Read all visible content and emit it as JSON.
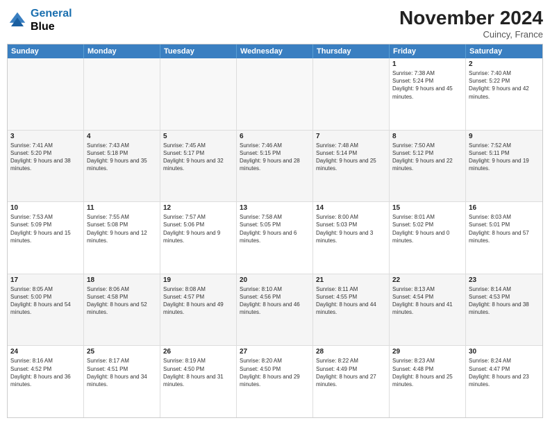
{
  "header": {
    "logo_line1": "General",
    "logo_line2": "Blue",
    "month_title": "November 2024",
    "location": "Cuincy, France"
  },
  "days_of_week": [
    "Sunday",
    "Monday",
    "Tuesday",
    "Wednesday",
    "Thursday",
    "Friday",
    "Saturday"
  ],
  "weeks": [
    [
      {
        "day": "",
        "empty": true
      },
      {
        "day": "",
        "empty": true
      },
      {
        "day": "",
        "empty": true
      },
      {
        "day": "",
        "empty": true
      },
      {
        "day": "",
        "empty": true
      },
      {
        "day": "1",
        "sunrise": "Sunrise: 7:38 AM",
        "sunset": "Sunset: 5:24 PM",
        "daylight": "Daylight: 9 hours and 45 minutes."
      },
      {
        "day": "2",
        "sunrise": "Sunrise: 7:40 AM",
        "sunset": "Sunset: 5:22 PM",
        "daylight": "Daylight: 9 hours and 42 minutes."
      }
    ],
    [
      {
        "day": "3",
        "sunrise": "Sunrise: 7:41 AM",
        "sunset": "Sunset: 5:20 PM",
        "daylight": "Daylight: 9 hours and 38 minutes."
      },
      {
        "day": "4",
        "sunrise": "Sunrise: 7:43 AM",
        "sunset": "Sunset: 5:18 PM",
        "daylight": "Daylight: 9 hours and 35 minutes."
      },
      {
        "day": "5",
        "sunrise": "Sunrise: 7:45 AM",
        "sunset": "Sunset: 5:17 PM",
        "daylight": "Daylight: 9 hours and 32 minutes."
      },
      {
        "day": "6",
        "sunrise": "Sunrise: 7:46 AM",
        "sunset": "Sunset: 5:15 PM",
        "daylight": "Daylight: 9 hours and 28 minutes."
      },
      {
        "day": "7",
        "sunrise": "Sunrise: 7:48 AM",
        "sunset": "Sunset: 5:14 PM",
        "daylight": "Daylight: 9 hours and 25 minutes."
      },
      {
        "day": "8",
        "sunrise": "Sunrise: 7:50 AM",
        "sunset": "Sunset: 5:12 PM",
        "daylight": "Daylight: 9 hours and 22 minutes."
      },
      {
        "day": "9",
        "sunrise": "Sunrise: 7:52 AM",
        "sunset": "Sunset: 5:11 PM",
        "daylight": "Daylight: 9 hours and 19 minutes."
      }
    ],
    [
      {
        "day": "10",
        "sunrise": "Sunrise: 7:53 AM",
        "sunset": "Sunset: 5:09 PM",
        "daylight": "Daylight: 9 hours and 15 minutes."
      },
      {
        "day": "11",
        "sunrise": "Sunrise: 7:55 AM",
        "sunset": "Sunset: 5:08 PM",
        "daylight": "Daylight: 9 hours and 12 minutes."
      },
      {
        "day": "12",
        "sunrise": "Sunrise: 7:57 AM",
        "sunset": "Sunset: 5:06 PM",
        "daylight": "Daylight: 9 hours and 9 minutes."
      },
      {
        "day": "13",
        "sunrise": "Sunrise: 7:58 AM",
        "sunset": "Sunset: 5:05 PM",
        "daylight": "Daylight: 9 hours and 6 minutes."
      },
      {
        "day": "14",
        "sunrise": "Sunrise: 8:00 AM",
        "sunset": "Sunset: 5:03 PM",
        "daylight": "Daylight: 9 hours and 3 minutes."
      },
      {
        "day": "15",
        "sunrise": "Sunrise: 8:01 AM",
        "sunset": "Sunset: 5:02 PM",
        "daylight": "Daylight: 9 hours and 0 minutes."
      },
      {
        "day": "16",
        "sunrise": "Sunrise: 8:03 AM",
        "sunset": "Sunset: 5:01 PM",
        "daylight": "Daylight: 8 hours and 57 minutes."
      }
    ],
    [
      {
        "day": "17",
        "sunrise": "Sunrise: 8:05 AM",
        "sunset": "Sunset: 5:00 PM",
        "daylight": "Daylight: 8 hours and 54 minutes."
      },
      {
        "day": "18",
        "sunrise": "Sunrise: 8:06 AM",
        "sunset": "Sunset: 4:58 PM",
        "daylight": "Daylight: 8 hours and 52 minutes."
      },
      {
        "day": "19",
        "sunrise": "Sunrise: 8:08 AM",
        "sunset": "Sunset: 4:57 PM",
        "daylight": "Daylight: 8 hours and 49 minutes."
      },
      {
        "day": "20",
        "sunrise": "Sunrise: 8:10 AM",
        "sunset": "Sunset: 4:56 PM",
        "daylight": "Daylight: 8 hours and 46 minutes."
      },
      {
        "day": "21",
        "sunrise": "Sunrise: 8:11 AM",
        "sunset": "Sunset: 4:55 PM",
        "daylight": "Daylight: 8 hours and 44 minutes."
      },
      {
        "day": "22",
        "sunrise": "Sunrise: 8:13 AM",
        "sunset": "Sunset: 4:54 PM",
        "daylight": "Daylight: 8 hours and 41 minutes."
      },
      {
        "day": "23",
        "sunrise": "Sunrise: 8:14 AM",
        "sunset": "Sunset: 4:53 PM",
        "daylight": "Daylight: 8 hours and 38 minutes."
      }
    ],
    [
      {
        "day": "24",
        "sunrise": "Sunrise: 8:16 AM",
        "sunset": "Sunset: 4:52 PM",
        "daylight": "Daylight: 8 hours and 36 minutes."
      },
      {
        "day": "25",
        "sunrise": "Sunrise: 8:17 AM",
        "sunset": "Sunset: 4:51 PM",
        "daylight": "Daylight: 8 hours and 34 minutes."
      },
      {
        "day": "26",
        "sunrise": "Sunrise: 8:19 AM",
        "sunset": "Sunset: 4:50 PM",
        "daylight": "Daylight: 8 hours and 31 minutes."
      },
      {
        "day": "27",
        "sunrise": "Sunrise: 8:20 AM",
        "sunset": "Sunset: 4:50 PM",
        "daylight": "Daylight: 8 hours and 29 minutes."
      },
      {
        "day": "28",
        "sunrise": "Sunrise: 8:22 AM",
        "sunset": "Sunset: 4:49 PM",
        "daylight": "Daylight: 8 hours and 27 minutes."
      },
      {
        "day": "29",
        "sunrise": "Sunrise: 8:23 AM",
        "sunset": "Sunset: 4:48 PM",
        "daylight": "Daylight: 8 hours and 25 minutes."
      },
      {
        "day": "30",
        "sunrise": "Sunrise: 8:24 AM",
        "sunset": "Sunset: 4:47 PM",
        "daylight": "Daylight: 8 hours and 23 minutes."
      }
    ]
  ]
}
